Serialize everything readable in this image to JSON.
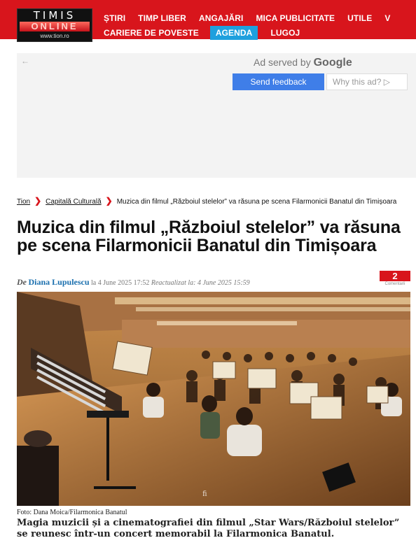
{
  "header": {
    "logo": {
      "line1": "TIMIS",
      "line2": "ONLINE",
      "line3": "www.tion.ro"
    },
    "nav_row1": [
      "ȘTIRI",
      "TIMP LIBER",
      "ANGAJĂRI",
      "MICA PUBLICITATE",
      "UTILE",
      "V"
    ],
    "nav_row2": [
      "CARIERE DE POVESTE",
      "AGENDA",
      "LUGOJ"
    ],
    "active_item": "AGENDA",
    "colors": {
      "bar": "#d8151c",
      "active": "#1ea0de"
    }
  },
  "ad": {
    "back_icon": "left-arrow-icon",
    "served_prefix": "Ad served by",
    "served_brand": "Google",
    "feedback_label": "Send feedback",
    "why_label": "Why this ad?",
    "why_icon": "play-triangle-icon"
  },
  "breadcrumb": {
    "items": [
      "Tion",
      "Capitală Culturală"
    ],
    "current": "Muzica din filmul „Războiul stelelor” va răsuna pe scena Filarmonicii Banatul din Timișoara"
  },
  "article": {
    "title": "Muzica din filmul „Războiul stelelor” va răsuna pe scena Filarmonicii Banatul din Timișoara",
    "by_prefix": "De",
    "author": "Diana Lupulescu",
    "date_text": "la 4 June 2025 17:52",
    "updated_text": "Reactualizat la: 4 June 2025 15:59",
    "comments_count": "2",
    "comments_label": "Comentarii",
    "photo_credit": "Foto: Dana Moica/Filarmonica Banatul",
    "lead": "Magia muzicii și a cinematografiei din filmul „Star Wars/Războiul stelelor” se reunesc într-un concert memorabil la Filarmonica Banatul."
  }
}
